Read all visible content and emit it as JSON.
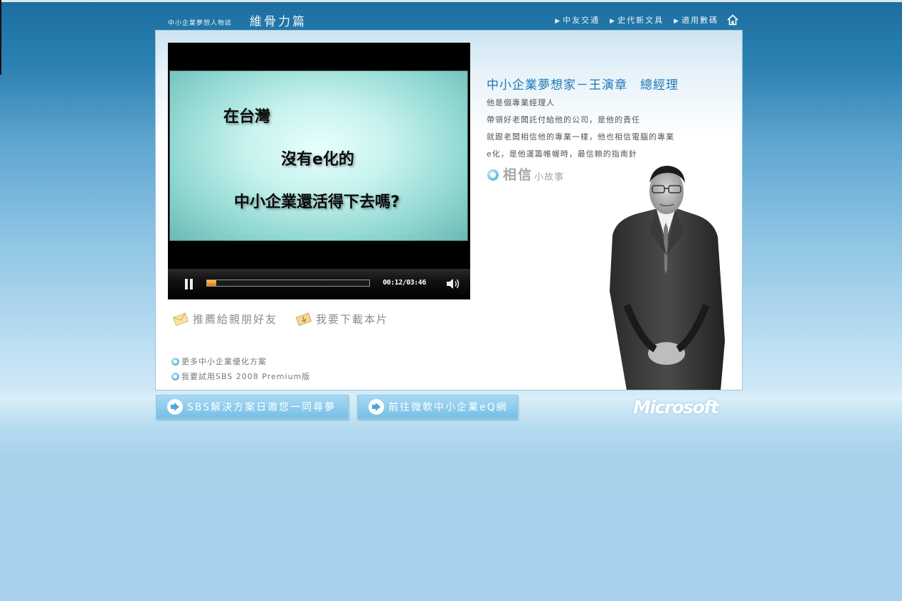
{
  "header": {
    "series_title": "中小企業夢想人物誌",
    "episode_title": "維骨力篇",
    "nav": [
      {
        "label": "中友交通"
      },
      {
        "label": "史代新文具"
      },
      {
        "label": "適用數碼"
      }
    ],
    "home_icon": "home-icon"
  },
  "video": {
    "caption_lines": [
      "在台灣",
      "沒有e化的",
      "中小企業還活得下去嗎?"
    ],
    "time_display": "00:12/03:46",
    "progress_fraction": 0.056,
    "state": "playing",
    "icons": {
      "pause": "pause-icon",
      "volume": "volume-icon"
    }
  },
  "actions": {
    "recommend_label": "推薦給親朋好友",
    "download_label": "我要下載本片"
  },
  "links": [
    {
      "label": "更多中小企業優化方案"
    },
    {
      "label": "我要試用SBS 2008 Premium版"
    }
  ],
  "profile": {
    "title": "中小企業夢想家－王演章　總經理",
    "description": [
      "他是個專業經理人",
      "帶領好老闆託付給他的公司，是他的責任",
      "就跟老闆相信他的專業一樣，他也相信電腦的專業",
      "e化，是他運籌帷幄時，最信賴的指南針"
    ],
    "story_big": "相信",
    "story_small": "小故事"
  },
  "bottom_buttons": [
    {
      "label": "SBS解決方案日邀您一同尋夢"
    },
    {
      "label": "前往微軟中小企業eQ網"
    }
  ],
  "brand_logo": "Microsoft",
  "colors": {
    "accent_blue": "#1b76b8",
    "progress_orange": "#e67a0a",
    "button_blue": "#75bfe6"
  }
}
